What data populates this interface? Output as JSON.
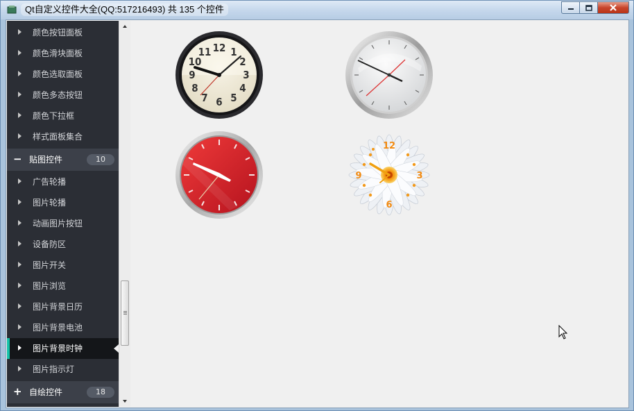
{
  "window": {
    "title": "Qt自定义控件大全(QQ:517216493) 共 135 个控件"
  },
  "sidebar": {
    "items_top": [
      {
        "label": "颜色按钮面板"
      },
      {
        "label": "颜色滑块面板"
      },
      {
        "label": "颜色选取面板"
      },
      {
        "label": "颜色多态按钮"
      },
      {
        "label": "颜色下拉框"
      },
      {
        "label": "样式面板集合"
      }
    ],
    "group_image": {
      "symbol": "−",
      "label": "贴图控件",
      "count": "10"
    },
    "items_image": [
      {
        "label": "广告轮播"
      },
      {
        "label": "图片轮播"
      },
      {
        "label": "动画图片按钮"
      },
      {
        "label": "设备防区"
      },
      {
        "label": "图片开关"
      },
      {
        "label": "图片浏览"
      },
      {
        "label": "图片背景日历"
      },
      {
        "label": "图片背景电池"
      },
      {
        "label": "图片背景时钟"
      },
      {
        "label": "图片指示灯"
      }
    ],
    "selected_label": "图片背景时钟",
    "group_draw": {
      "symbol": "+",
      "label": "自绘控件",
      "count": "18"
    }
  },
  "clocks": [
    {
      "name": "dark-bezel-clock",
      "numerals": [
        "12",
        "1",
        "2",
        "3",
        "4",
        "5",
        "6",
        "7",
        "8",
        "9",
        "10",
        "11"
      ]
    },
    {
      "name": "silver-clock"
    },
    {
      "name": "red-clock"
    },
    {
      "name": "daisy-clock",
      "numerals": [
        "12",
        "3",
        "6",
        "9"
      ]
    }
  ],
  "colors": {
    "accent": "#17c3a9",
    "sidebar_bg": "#2b2e35",
    "group_bg": "#3c4049",
    "selected_bg": "#141619",
    "content_bg": "#f0f0f0"
  }
}
